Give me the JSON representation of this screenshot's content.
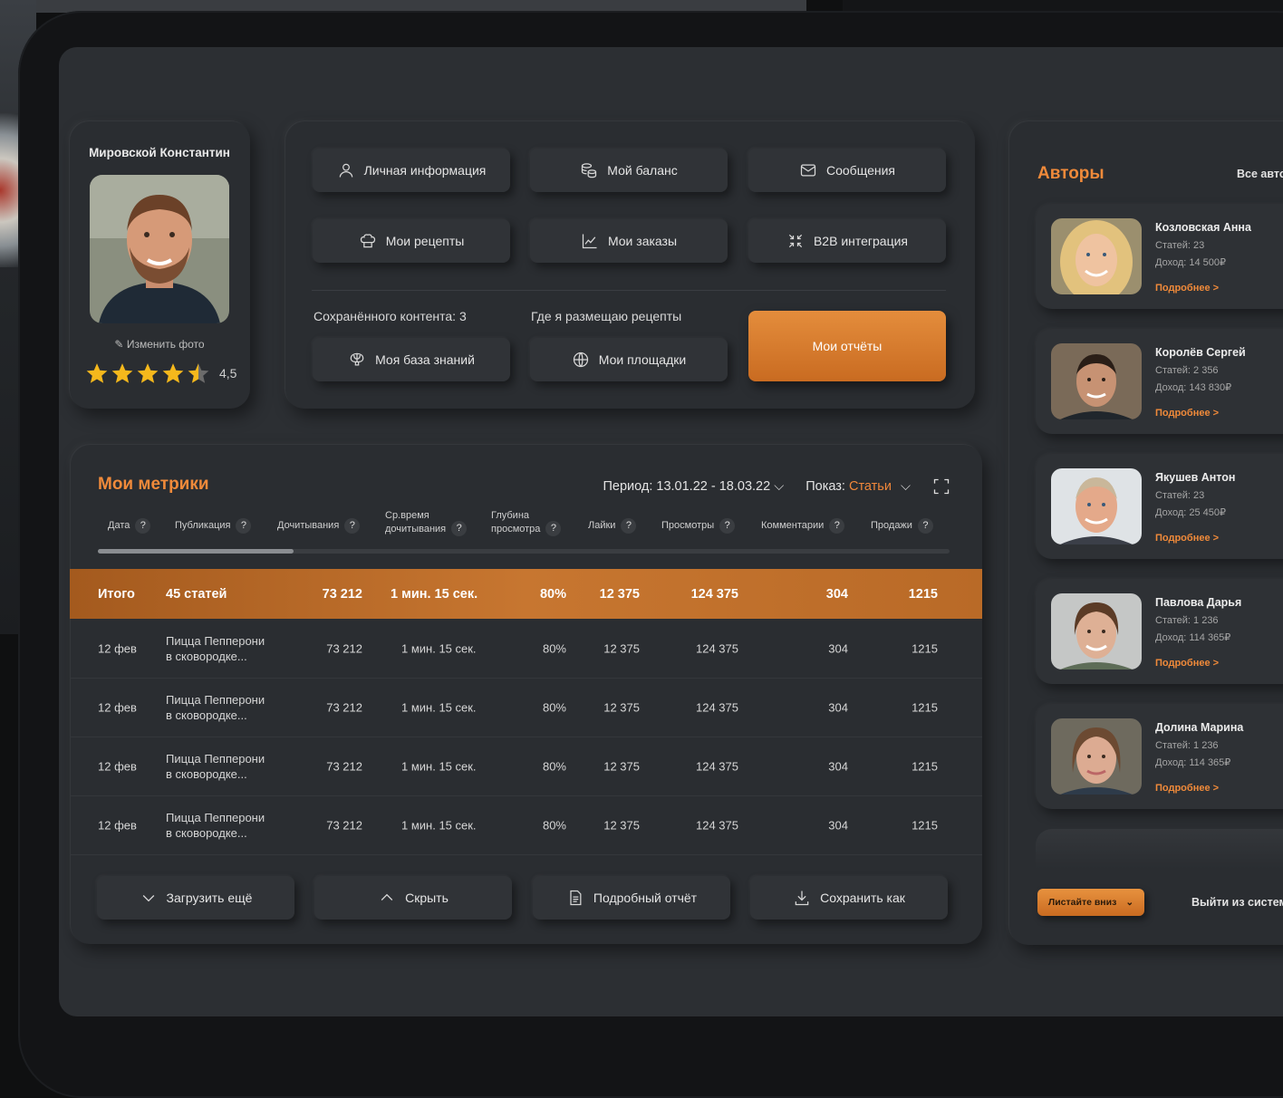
{
  "profile": {
    "name": "Мировской Константин",
    "edit_photo": "Изменить фото",
    "rating": "4,5",
    "stars_value": 4.5
  },
  "menu": {
    "personal_info": "Личная информация",
    "balance": "Мой баланс",
    "messages": "Сообщения",
    "recipes": "Мои рецепты",
    "orders": "Мои заказы",
    "b2b": "B2B интеграция",
    "saved_content": "Сохранённого контента: 3",
    "where_recipes": "Где я размещаю рецепты",
    "knowledge_base": "Моя база знаний",
    "platforms": "Мои площадки",
    "reports": "Мои отчёты"
  },
  "metrics": {
    "title": "Мои метрики",
    "period_label": "Период: 13.01.22 - 18.03.22",
    "show_label": "Показ:",
    "show_value": "Статьи",
    "headers": {
      "date": "Дата",
      "publication": "Публикация",
      "reads": "Дочитывания",
      "avg_time_1": "Ср.время",
      "avg_time_2": "дочитывания",
      "depth_1": "Глубина",
      "depth_2": "просмотра",
      "likes": "Лайки",
      "views": "Просмотры",
      "comments": "Комментарии",
      "sales": "Продажи",
      "help": "?"
    },
    "total": {
      "label": "Итого",
      "publication": "45 статей",
      "reads": "73 212",
      "avg_time": "1 мин. 15 сек.",
      "depth": "80%",
      "likes": "12 375",
      "views": "124 375",
      "comments": "304",
      "sales": "1215"
    },
    "rows": [
      {
        "date": "12 фев",
        "pub1": "Пицца Пепперони",
        "pub2": "в сковородке...",
        "reads": "73 212",
        "avg_time": "1 мин. 15 сек.",
        "depth": "80%",
        "likes": "12 375",
        "views": "124 375",
        "comments": "304",
        "sales": "1215"
      },
      {
        "date": "12 фев",
        "pub1": "Пицца Пепперони",
        "pub2": "в сковородке...",
        "reads": "73 212",
        "avg_time": "1 мин. 15 сек.",
        "depth": "80%",
        "likes": "12 375",
        "views": "124 375",
        "comments": "304",
        "sales": "1215"
      },
      {
        "date": "12 фев",
        "pub1": "Пицца Пепперони",
        "pub2": "в сковородке...",
        "reads": "73 212",
        "avg_time": "1 мин. 15 сек.",
        "depth": "80%",
        "likes": "12 375",
        "views": "124 375",
        "comments": "304",
        "sales": "1215"
      },
      {
        "date": "12 фев",
        "pub1": "Пицца Пепперони",
        "pub2": "в сковородке...",
        "reads": "73 212",
        "avg_time": "1 мин. 15 сек.",
        "depth": "80%",
        "likes": "12 375",
        "views": "124 375",
        "comments": "304",
        "sales": "1215"
      }
    ],
    "buttons": {
      "load_more": "Загрузить ещё",
      "hide": "Скрыть",
      "detailed": "Подробный отчёт",
      "save_as": "Сохранить как"
    }
  },
  "authors": {
    "title": "Авторы",
    "all_link": "Все авто",
    "more": "Подробнее >",
    "list": [
      {
        "name": "Козловская Анна",
        "articles": "Статей: 23",
        "income": "Доход: 14 500₽"
      },
      {
        "name": "Королёв Сергей",
        "articles": "Статей: 2 356",
        "income": "Доход: 143 830₽"
      },
      {
        "name": "Якушев Антон",
        "articles": "Статей: 23",
        "income": "Доход: 25 450₽"
      },
      {
        "name": "Павлова Дарья",
        "articles": "Статей: 1 236",
        "income": "Доход: 114 365₽"
      },
      {
        "name": "Долина Марина",
        "articles": "Статей: 1 236",
        "income": "Доход: 114 365₽"
      }
    ],
    "scroll_down": "Листайте вниз",
    "logout": "Выйти из систем"
  },
  "colors": {
    "accent": "#f08a3a",
    "panel": "#2a2d31",
    "background": "#2c2f33"
  }
}
